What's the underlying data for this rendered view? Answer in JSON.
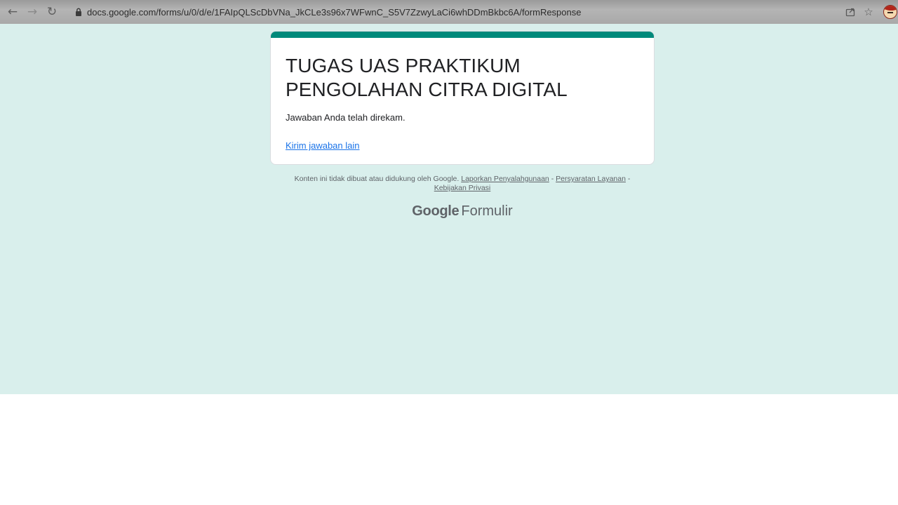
{
  "browser": {
    "url": "docs.google.com/forms/u/0/d/e/1FAIpQLScDbVNa_JkCLe3s96x7WFwnC_S5V7ZzwyLaCi6whDDmBkbc6A/formResponse"
  },
  "form": {
    "title": "TUGAS UAS PRAKTIKUM PENGOLAHAN CITRA DIGITAL",
    "confirmation_message": "Jawaban Anda telah direkam.",
    "resubmit_link": "Kirim jawaban lain"
  },
  "footer": {
    "disclaimer": "Konten ini tidak dibuat atau didukung oleh Google.",
    "report_abuse": "Laporkan Penyalahgunaan",
    "separator": "-",
    "terms": "Persyaratan Layanan",
    "privacy": "Kebijakan Privasi"
  },
  "branding": {
    "google": "Google",
    "product": "Formulir"
  },
  "colors": {
    "page_background": "#d9efec",
    "accent": "#00897b",
    "link": "#1a73e8"
  }
}
